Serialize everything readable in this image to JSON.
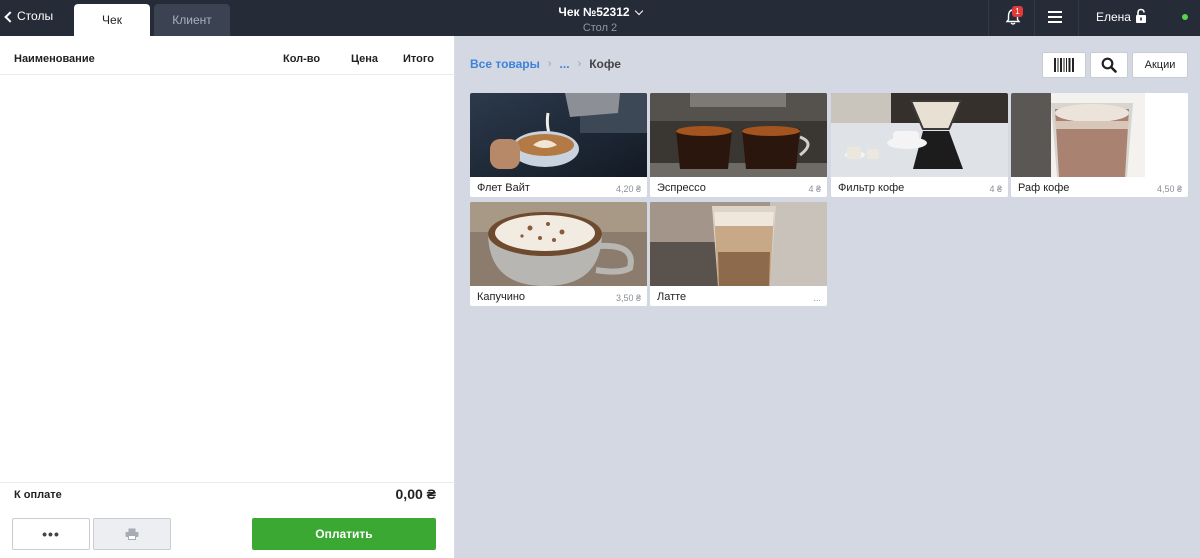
{
  "topbar": {
    "back_label": "Столы",
    "tabs": [
      {
        "label": "Чек",
        "active": true
      },
      {
        "label": "Клиент",
        "active": false
      }
    ],
    "title": "Чек №52312",
    "subtitle": "Стол 2",
    "notification_badge": "1",
    "user_name": "Елена",
    "colors": {
      "bar": "#262c37",
      "online": "#5ad34a",
      "badge": "#e23a3a"
    }
  },
  "order": {
    "columns": [
      "Наименование",
      "Кол-во",
      "Цена",
      "Итого"
    ],
    "items": [],
    "to_pay_label": "К оплате",
    "to_pay_value": "0,00 ₴",
    "more_label": "•••",
    "pay_label": "Оплатить",
    "pay_color": "#3aa832"
  },
  "catalog": {
    "breadcrumb": {
      "root": "Все товары",
      "middle": "...",
      "current": "Кофе"
    },
    "promo_label": "Акции",
    "products": [
      {
        "name": "Флет Вайт",
        "price": "4,20 ₴",
        "image": "flat-white-image"
      },
      {
        "name": "Эспрессо",
        "price": "4 ₴",
        "image": "espresso-image"
      },
      {
        "name": "Фильтр кофе",
        "price": "4 ₴",
        "image": "filter-coffee-image"
      },
      {
        "name": "Раф кофе",
        "price": "4,50 ₴",
        "image": "raf-coffee-image"
      },
      {
        "name": "Капучино",
        "price": "3,50 ₴",
        "image": "cappuccino-image"
      },
      {
        "name": "Латте",
        "price": "...",
        "image": "latte-image"
      }
    ]
  }
}
